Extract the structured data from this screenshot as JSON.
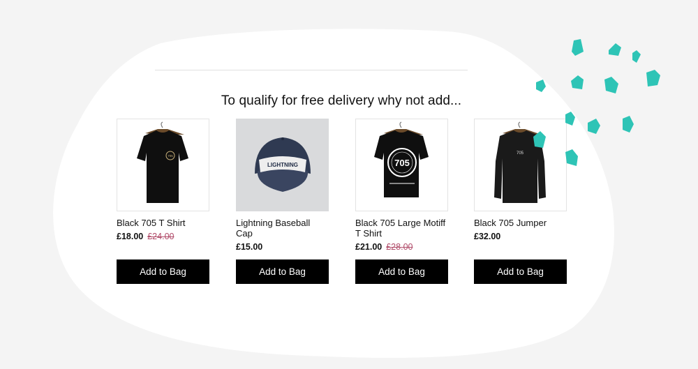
{
  "section": {
    "heading": "To qualify for free delivery why not add..."
  },
  "products": [
    {
      "name": "Black 705 T Shirt",
      "price": "£18.00",
      "was_price": "£24.00",
      "image": "black-tshirt-small-logo",
      "button_label": "Add to Bag"
    },
    {
      "name": "Lightning Baseball Cap",
      "price": "£15.00",
      "was_price": "",
      "image": "denim-baseball-cap",
      "button_label": "Add to Bag"
    },
    {
      "name": "Black 705 Large Motiff T Shirt",
      "price": "£21.00",
      "was_price": "£28.00",
      "image": "black-tshirt-large-motif",
      "button_label": "Add to Bag"
    },
    {
      "name": "Black 705 Jumper",
      "price": "£32.00",
      "was_price": "",
      "image": "black-jumper",
      "button_label": "Add to Bag"
    }
  ],
  "image_text": {
    "tshirt_logo": "705",
    "cap_patch": "LIGHTNING",
    "motif": "705",
    "jumper": "705"
  },
  "colors": {
    "background": "#f4f4f4",
    "panel": "#ffffff",
    "button": "#000000",
    "sale_price": "#b04a68",
    "accent_dashes": "#2ec4b6"
  }
}
